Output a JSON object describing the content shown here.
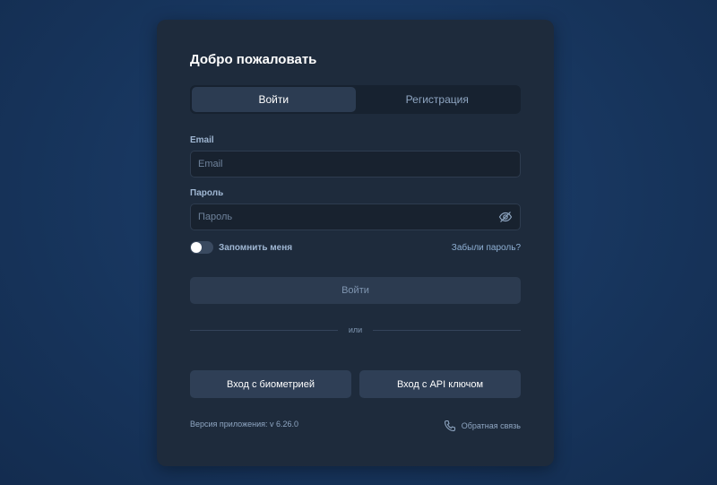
{
  "login": {
    "title": "Добро пожаловать",
    "tabs": [
      {
        "label": "Войти",
        "active": true
      },
      {
        "label": "Регистрация",
        "active": false
      }
    ],
    "email": {
      "label": "Email",
      "placeholder": "Email",
      "value": ""
    },
    "password": {
      "label": "Пароль",
      "placeholder": "Пароль",
      "value": "",
      "icon": "eye-off-icon"
    },
    "remember": {
      "label": "Запомнить меня",
      "checked": false
    },
    "forgot_label": "Забыли пароль?",
    "submit_label": "Войти",
    "divider_label": "или",
    "biometric_label": "Вход с биометрией",
    "api_key_label": "Вход с API ключом",
    "version_label": "Версия приложения: v 6.26.0",
    "feedback_label": "Обратная связь",
    "feedback_icon": "phone-icon"
  },
  "colors": {
    "background": "#183760",
    "card": "#1e2b3c",
    "accent_text": "#8fb0d4"
  }
}
